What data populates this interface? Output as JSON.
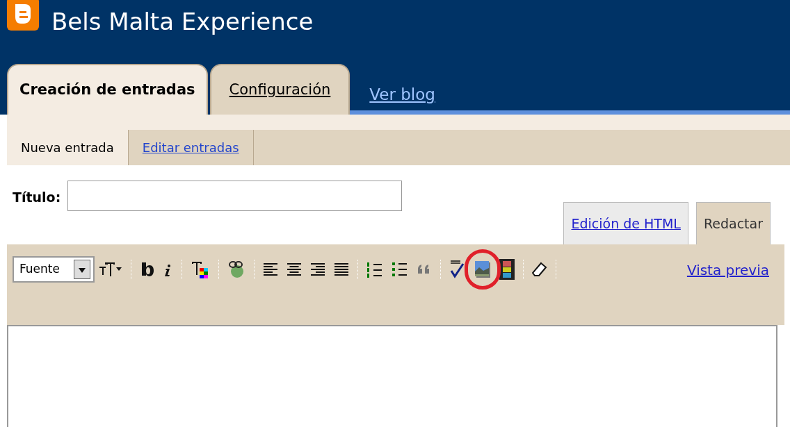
{
  "blog": {
    "title": "Bels Malta Experience"
  },
  "tabs": [
    {
      "label": "Creación de entradas",
      "selected": true,
      "kind": "tab"
    },
    {
      "label": "Configuración",
      "selected": false,
      "kind": "tab"
    },
    {
      "label": "Ver blog",
      "selected": false,
      "kind": "link"
    }
  ],
  "subtabs": [
    {
      "label": "Nueva entrada",
      "selected": true
    },
    {
      "label": "Editar entradas",
      "selected": false
    }
  ],
  "title_field": {
    "label": "Título:"
  },
  "editor_modes": [
    {
      "label": "Edición de HTML",
      "selected": false
    },
    {
      "label": "Redactar",
      "selected": true
    }
  ],
  "toolbar": {
    "font_select": {
      "value": "Fuente"
    },
    "tools": [
      {
        "kind": "font-size",
        "circled": false
      },
      {
        "kind": "separator",
        "circled": false
      },
      {
        "kind": "bold",
        "circled": false
      },
      {
        "kind": "italic",
        "circled": false
      },
      {
        "kind": "separator",
        "circled": false
      },
      {
        "kind": "text-color",
        "circled": false
      },
      {
        "kind": "separator",
        "circled": false
      },
      {
        "kind": "link",
        "circled": false
      },
      {
        "kind": "separator",
        "circled": false
      },
      {
        "kind": "align-left",
        "circled": false
      },
      {
        "kind": "align-center",
        "circled": false
      },
      {
        "kind": "align-right",
        "circled": false
      },
      {
        "kind": "justify",
        "circled": false
      },
      {
        "kind": "separator",
        "circled": false
      },
      {
        "kind": "numbered-list",
        "circled": false
      },
      {
        "kind": "bullet-list",
        "circled": false
      },
      {
        "kind": "quote",
        "circled": false
      },
      {
        "kind": "separator",
        "circled": false
      },
      {
        "kind": "spellcheck",
        "circled": false
      },
      {
        "kind": "image",
        "circled": true
      },
      {
        "kind": "video",
        "circled": false
      },
      {
        "kind": "separator",
        "circled": false
      },
      {
        "kind": "eraser",
        "circled": false
      },
      {
        "kind": "separator",
        "circled": false
      }
    ],
    "preview_link": "Vista previa"
  }
}
